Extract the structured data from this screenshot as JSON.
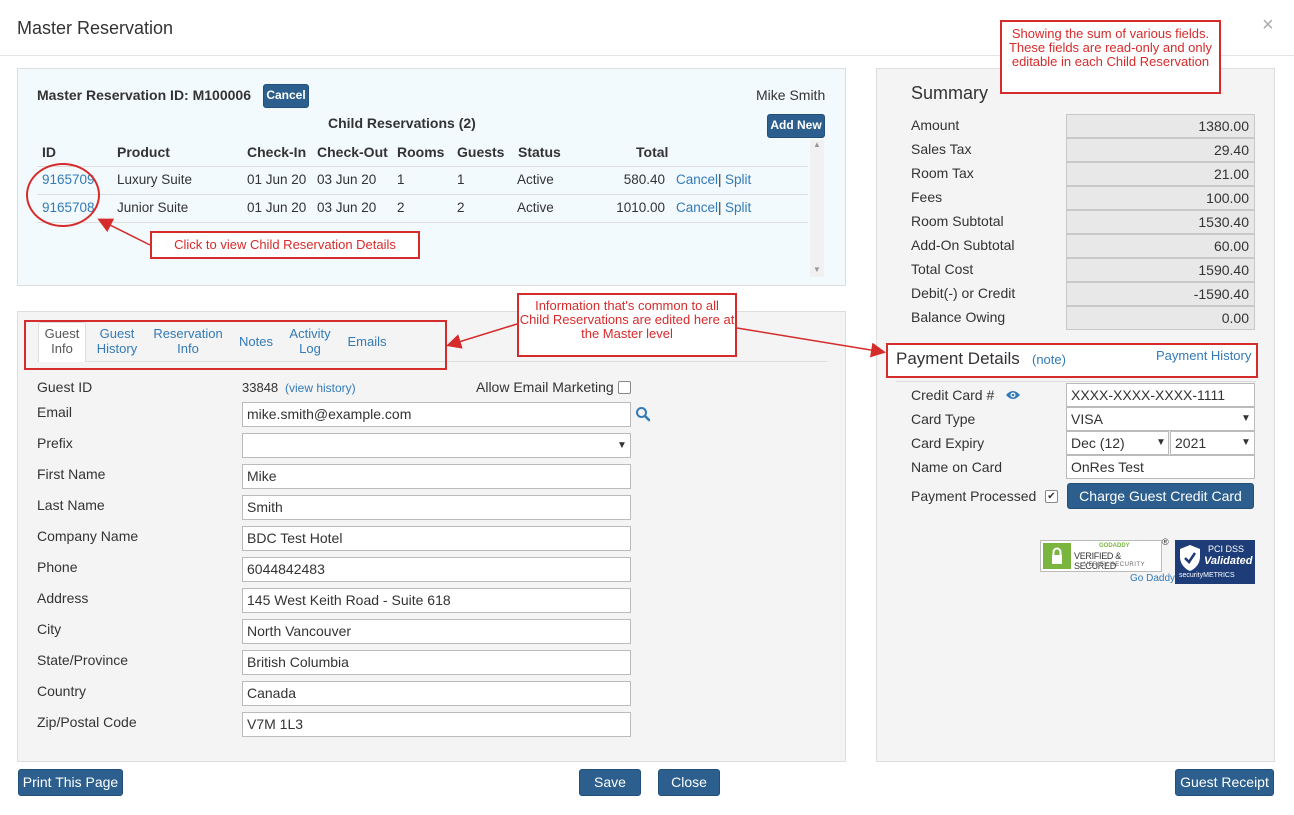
{
  "modal": {
    "title": "Master Reservation",
    "close_glyph": "×"
  },
  "reservation": {
    "id_label": "Master Reservation ID: M100006",
    "cancel_label": "Cancel",
    "guest_name": "Mike Smith",
    "child_title": "Child Reservations (2)",
    "add_new_label": "Add New",
    "columns": [
      "ID",
      "Product",
      "Check-In",
      "Check-Out",
      "Rooms",
      "Guests",
      "Status",
      "Total"
    ],
    "rows": [
      {
        "id": "9165709",
        "product": "Luxury Suite",
        "check_in": "01 Jun 20",
        "check_out": "03 Jun 20",
        "rooms": "1",
        "guests": "1",
        "status": "Active",
        "total": "580.40",
        "cancel": "Cancel",
        "sep": "|",
        "split": "Split"
      },
      {
        "id": "9165708",
        "product": "Junior Suite",
        "check_in": "01 Jun 20",
        "check_out": "03 Jun 20",
        "rooms": "2",
        "guests": "2",
        "status": "Active",
        "total": "1010.00",
        "cancel": "Cancel",
        "sep": "|",
        "split": "Split"
      }
    ]
  },
  "callouts": {
    "child_details": "Click to view Child Reservation Details",
    "common_info": "Information that's common to all Child Reservations are edited here at the Master level",
    "summary_info": "Showing the sum of various fields. These fields are read-only and only editable in each Child Reservation"
  },
  "tabs": [
    {
      "line1": "Guest",
      "line2": "Info"
    },
    {
      "line1": "Guest",
      "line2": "History"
    },
    {
      "line1": "Reservation",
      "line2": "Info"
    },
    {
      "line1": "Notes",
      "line2": ""
    },
    {
      "line1": "Activity",
      "line2": "Log"
    },
    {
      "line1": "Emails",
      "line2": ""
    }
  ],
  "guest": {
    "guest_id_label": "Guest ID",
    "guest_id": "33848",
    "view_history": "(view history)",
    "allow_email_label": "Allow Email Marketing",
    "email_label": "Email",
    "email": "mike.smith@example.com",
    "prefix_label": "Prefix",
    "prefix": "",
    "first_name_label": "First Name",
    "first_name": "Mike",
    "last_name_label": "Last Name",
    "last_name": "Smith",
    "company_label": "Company Name",
    "company": "BDC Test Hotel",
    "phone_label": "Phone",
    "phone": "6044842483",
    "address_label": "Address",
    "address": "145 West Keith Road - Suite 618",
    "city_label": "City",
    "city": "North Vancouver",
    "state_label": "State/Province",
    "state": "British Columbia",
    "country_label": "Country",
    "country": "Canada",
    "zip_label": "Zip/Postal Code",
    "zip": "V7M 1L3"
  },
  "summary": {
    "title": "Summary",
    "items": [
      {
        "label": "Amount",
        "value": "1380.00"
      },
      {
        "label": "Sales Tax",
        "value": "29.40"
      },
      {
        "label": "Room Tax",
        "value": "21.00"
      },
      {
        "label": "Fees",
        "value": "100.00"
      },
      {
        "label": "Room Subtotal",
        "value": "1530.40"
      },
      {
        "label": "Add-On Subtotal",
        "value": "60.00"
      },
      {
        "label": "Total Cost",
        "value": "1590.40"
      },
      {
        "label": "Debit(-) or Credit",
        "value": "-1590.40"
      },
      {
        "label": "Balance Owing",
        "value": "0.00"
      }
    ]
  },
  "payment": {
    "title": "Payment Details",
    "note": "(note)",
    "history": "Payment History",
    "cc_label": "Credit Card #",
    "cc": "XXXX-XXXX-XXXX-1111",
    "type_label": "Card Type",
    "type": "VISA",
    "expiry_label": "Card Expiry",
    "expiry_month": "Dec (12)",
    "expiry_year": "2021",
    "name_label": "Name on Card",
    "name": "OnRes Test",
    "processed_label": "Payment Processed",
    "charge_label": "Charge Guest Credit Card"
  },
  "badges": {
    "godaddy_top": "GODADDY",
    "godaddy_main": "VERIFIED & SECURED",
    "godaddy_sub": "VERIFY SECURITY",
    "godaddy_link": "Go Daddy",
    "registered": "®",
    "pci_top": "PCI DSS",
    "pci_main": "Validated",
    "pci_sub": "securityMETRICS"
  },
  "footer": {
    "print": "Print This Page",
    "save": "Save",
    "close": "Close",
    "receipt": "Guest Receipt"
  },
  "colors": {
    "primary": "#2c5f8e",
    "callout": "#d62b2b",
    "link": "#337ab7"
  }
}
